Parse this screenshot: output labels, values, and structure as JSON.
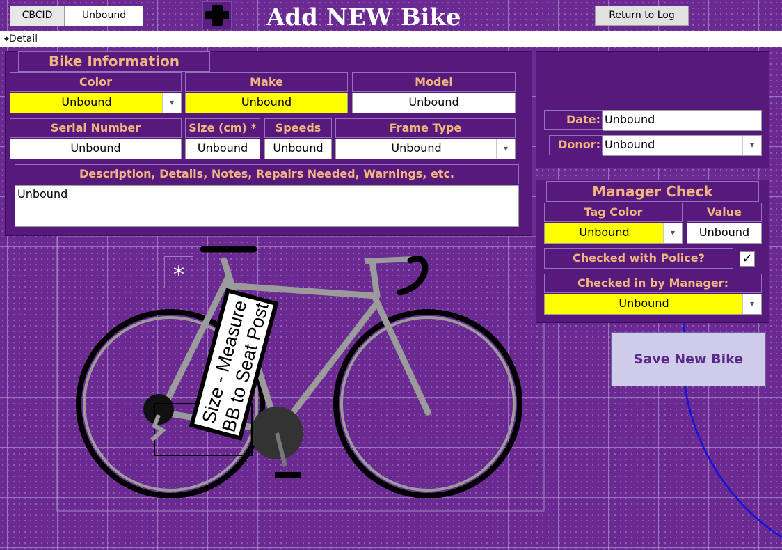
{
  "header": {
    "cbcid_label": "CBCID",
    "cbcid_value": "Unbound",
    "title": "Add NEW Bike",
    "return_button": "Return to Log"
  },
  "section_bar": {
    "label": "Detail"
  },
  "bike_info": {
    "title": "Bike Information",
    "color": {
      "label": "Color",
      "value": "Unbound"
    },
    "make": {
      "label": "Make",
      "value": "Unbound"
    },
    "model": {
      "label": "Model",
      "value": "Unbound"
    },
    "serial": {
      "label": "Serial Number",
      "value": "Unbound"
    },
    "size": {
      "label": "Size (cm) *",
      "value": "Unbound"
    },
    "speeds": {
      "label": "Speeds",
      "value": "Unbound"
    },
    "frame_type": {
      "label": "Frame Type",
      "value": "Unbound"
    },
    "description": {
      "label": "Description, Details, Notes, Repairs Needed, Warnings, etc.",
      "value": "Unbound"
    }
  },
  "intake": {
    "date": {
      "label": "Date:",
      "value": "Unbound"
    },
    "donor": {
      "label": "Donor:",
      "value": "Unbound"
    }
  },
  "manager_check": {
    "title": "Manager Check",
    "tag_color": {
      "label": "Tag Color",
      "value": "Unbound"
    },
    "value": {
      "label": "Value",
      "value": "Unbound"
    },
    "police": {
      "label": "Checked with Police?",
      "checked": true,
      "mark": "✓"
    },
    "checked_in_by": {
      "label": "Checked in by Manager:",
      "value": "Unbound"
    }
  },
  "save_button": "Save New Bike",
  "measure_note": {
    "asterisk": "*",
    "line1": "Size - Measure",
    "line2": "BB to Seat Post"
  },
  "icons": {
    "dropdown": "▾",
    "plus": "plus-icon",
    "section": "◆"
  },
  "colors": {
    "background": "#6a2a92",
    "panel": "#561a7c",
    "label_text": "#f1b67f",
    "highlight": "#ffff00",
    "save_button": "#cfcbeb"
  }
}
